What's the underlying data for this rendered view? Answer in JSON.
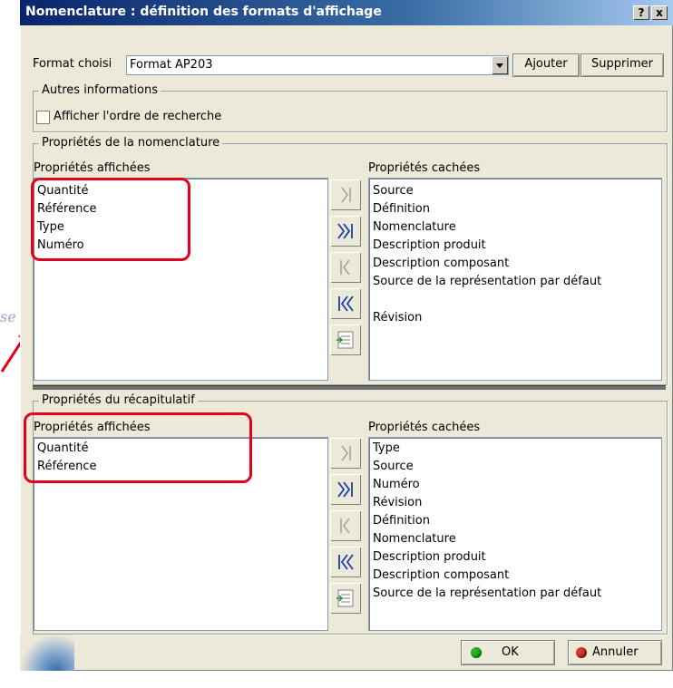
{
  "window": {
    "title": "Nomenclature : définition des formats d'affichage",
    "help_label": "?",
    "close_label": "x"
  },
  "format": {
    "label": "Format choisi",
    "value": "Format AP203",
    "add_label": "Ajouter",
    "delete_label": "Supprimer"
  },
  "other_info": {
    "legend": "Autres informations",
    "show_search_order_label": "Afficher l'ordre de recherche",
    "show_search_order_checked": false
  },
  "bom_properties": {
    "legend": "Propriétés de la nomenclature",
    "displayed_header": "Propriétés affichées",
    "hidden_header": "Propriétés cachées",
    "displayed": [
      "Quantité",
      "Référence",
      "Type",
      "Numéro"
    ],
    "hidden": [
      "Source",
      "Définition",
      "Nomenclature",
      "Description produit",
      "Description composant",
      "Source de la représentation par défaut",
      "",
      "Révision"
    ]
  },
  "summary_properties": {
    "legend": "Propriétés du récapitulatif",
    "displayed_header": "Propriétés affichées",
    "hidden_header": "Propriétés cachées",
    "displayed": [
      "Quantité",
      "Référence"
    ],
    "hidden": [
      "Type",
      "Source",
      "Numéro",
      "Révision",
      "Définition",
      "Nomenclature",
      "Description produit",
      "Description composant",
      "Source de la représentation par défaut"
    ]
  },
  "footer": {
    "ok_label": "OK",
    "cancel_label": "Annuler"
  },
  "artifact": {
    "text": "se"
  },
  "colors": {
    "title_bar": "#0a246a",
    "dialog_bg": "#ece9d8",
    "highlight": "#e3001b",
    "ok_green": "#2db52d",
    "cancel_red": "#d93a2b"
  }
}
